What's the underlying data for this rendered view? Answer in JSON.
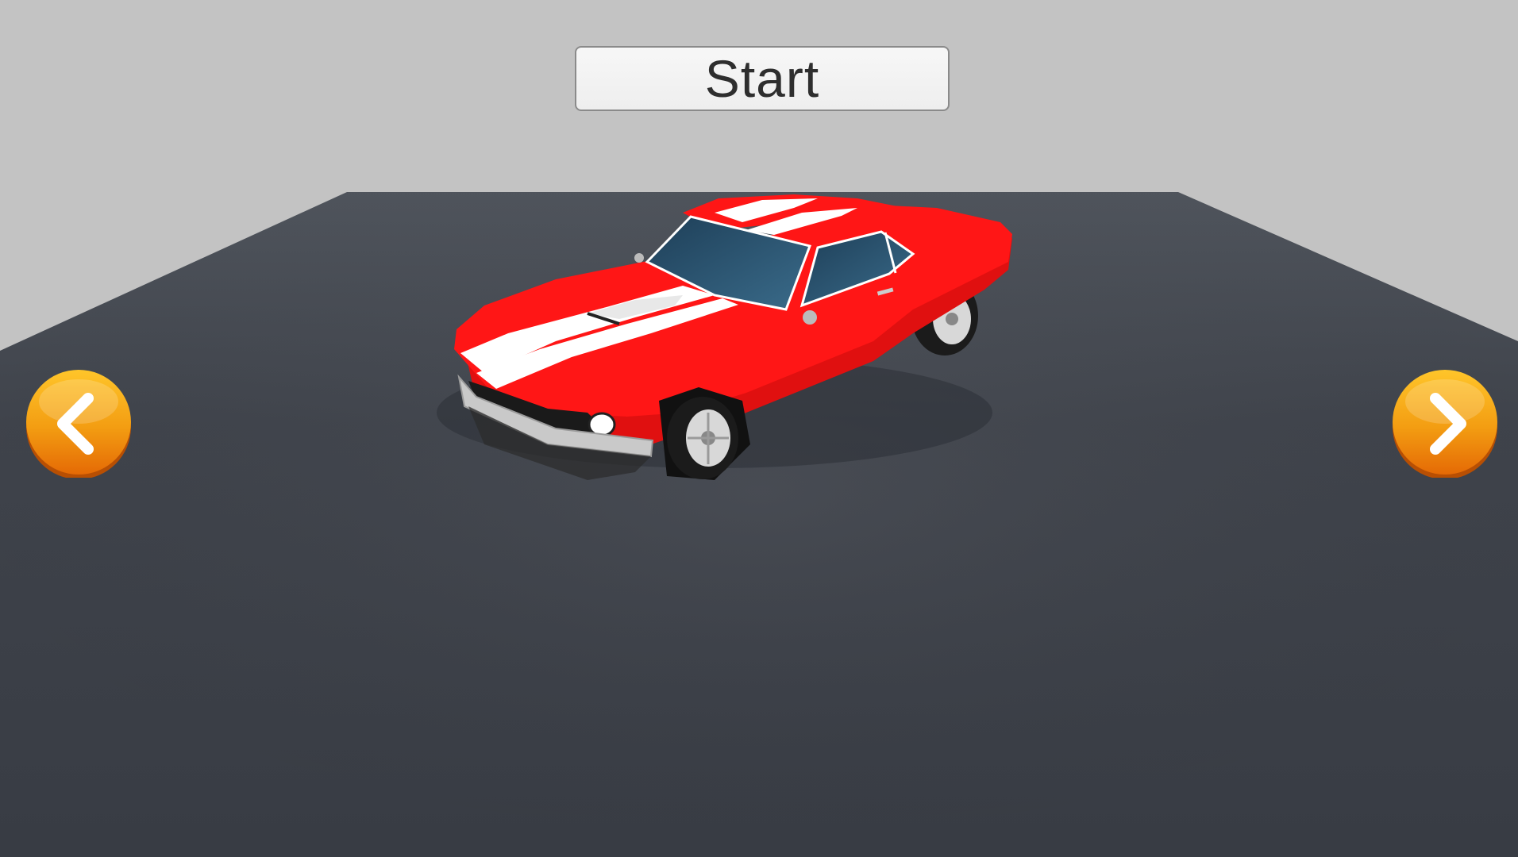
{
  "scene": {
    "sky_color": "#c3c3c3",
    "floor_color": "#3c4049",
    "car": {
      "body_color": "#ff1616",
      "stripe_color": "#ffffff",
      "glass_color": "#2c5470"
    }
  },
  "ui": {
    "start_label": "Start",
    "prev_icon": "chevron-left-icon",
    "next_icon": "chevron-right-icon",
    "arrow_color": "#f09a10"
  }
}
